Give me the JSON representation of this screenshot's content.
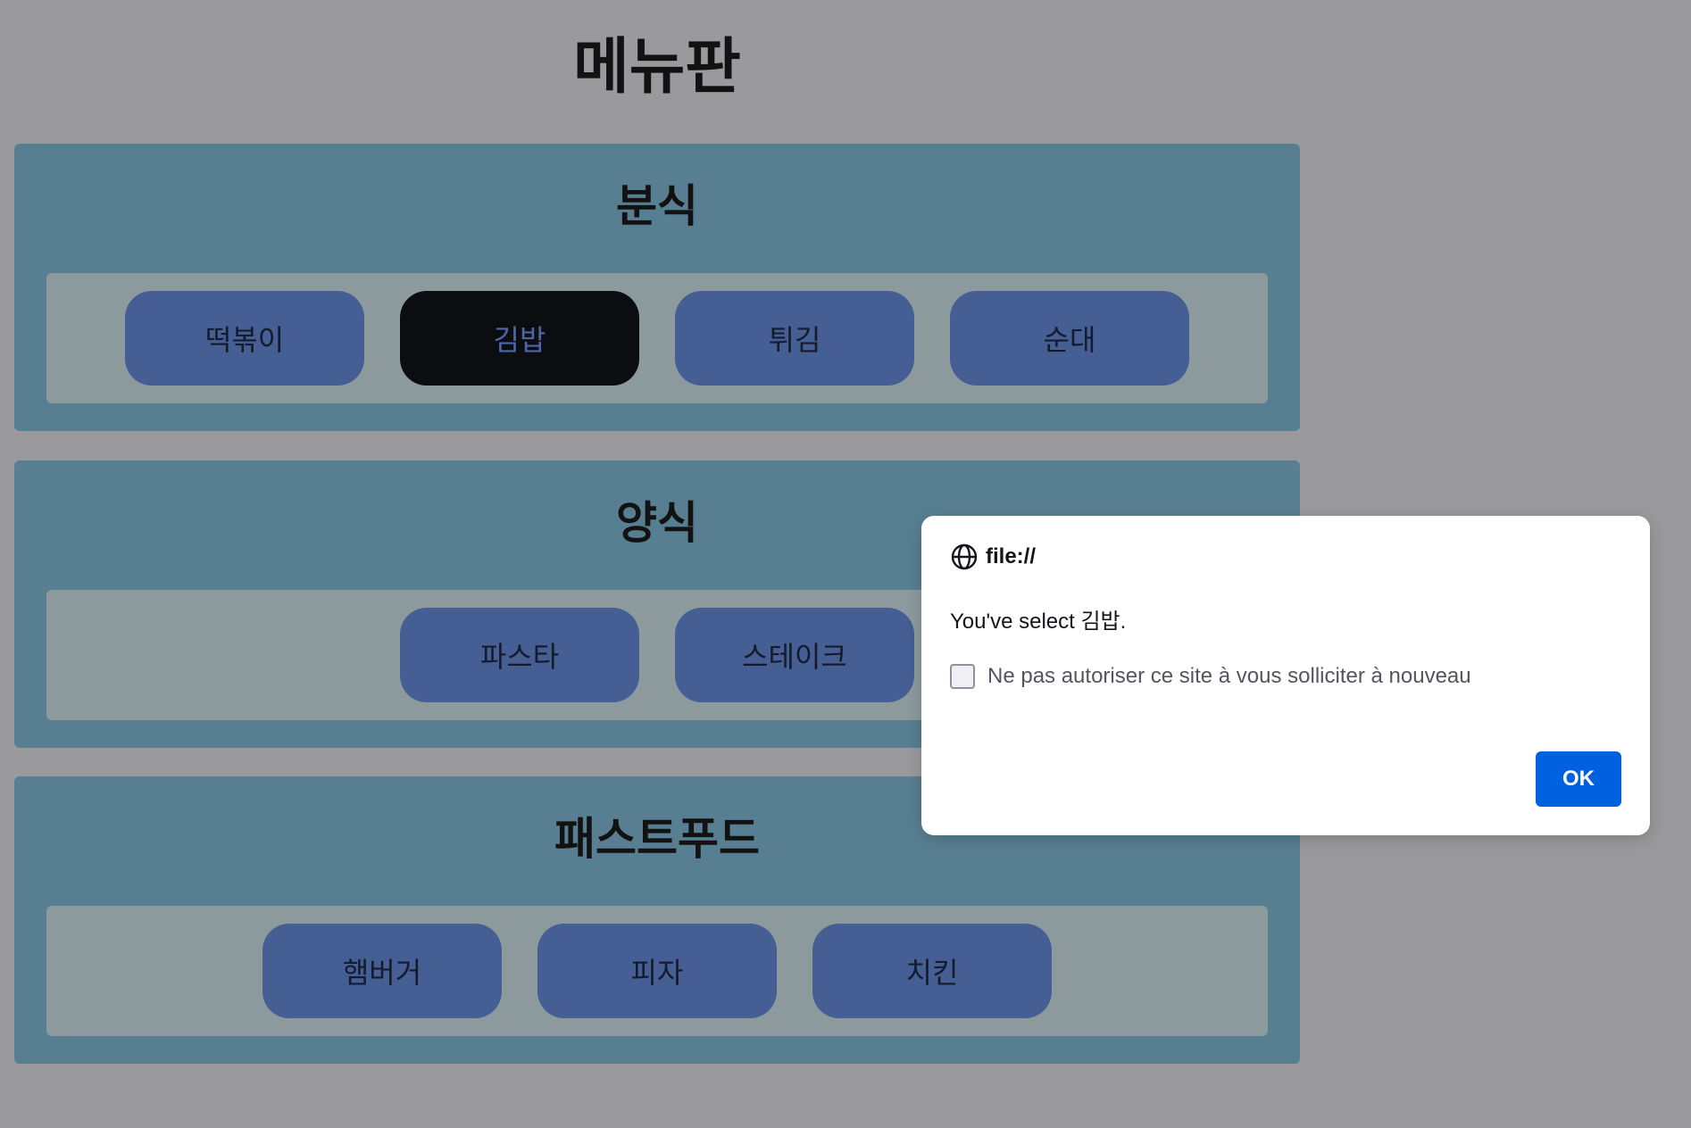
{
  "page": {
    "title": "메뉴판"
  },
  "categories": [
    {
      "title": "분식",
      "items": [
        {
          "label": "떡볶이"
        },
        {
          "label": "김밥"
        },
        {
          "label": "튀김"
        },
        {
          "label": "순대"
        }
      ]
    },
    {
      "title": "양식",
      "items": [
        {
          "label": "파스타"
        },
        {
          "label": "스테이크"
        }
      ]
    },
    {
      "title": "패스트푸드",
      "items": [
        {
          "label": "햄버거"
        },
        {
          "label": "피자"
        },
        {
          "label": "치킨"
        }
      ]
    }
  ],
  "selected_item": "김밥",
  "dialog": {
    "origin": "file://",
    "message": "You've select 김밥.",
    "checkbox_label": "Ne pas autoriser ce site à vous solliciter à nouveau",
    "checkbox_checked": false,
    "ok_label": "OK"
  },
  "colors": {
    "backdrop": "#9a9a9c",
    "category_panel": "#587f91",
    "item_row": "#8c9a9e",
    "menu_button": "#455e93",
    "menu_button_active": "#0c0d10",
    "ok_button": "#0061e0"
  }
}
